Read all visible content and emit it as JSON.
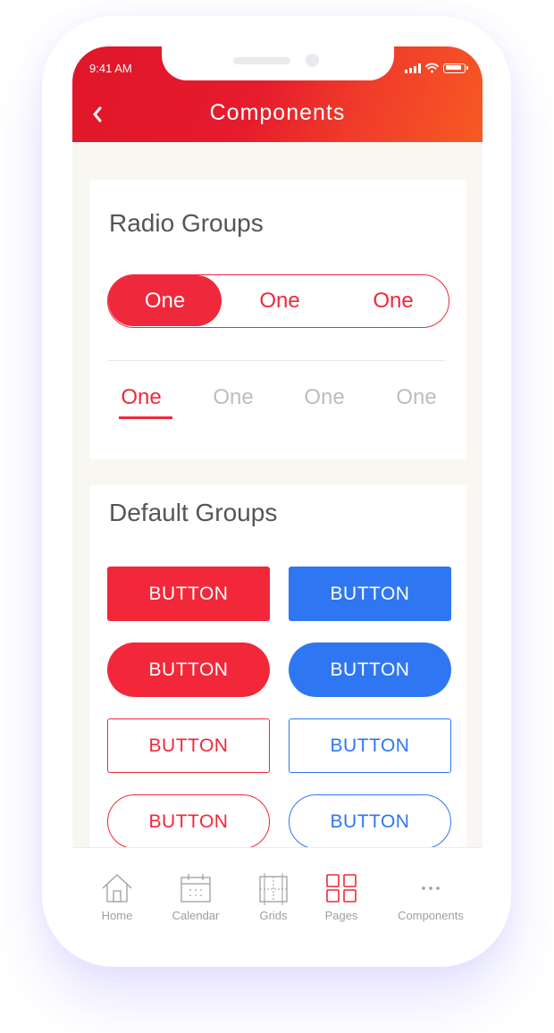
{
  "status_bar": {
    "time": "9:41 AM"
  },
  "header": {
    "title": "Components",
    "back_icon": "chevron-left-icon"
  },
  "colors": {
    "red": "#f22739",
    "blue": "#2f76f2",
    "header_start": "#e0162a",
    "header_end": "#f75a23"
  },
  "radio_groups": {
    "title": "Radio Groups",
    "segmented": {
      "options": [
        "One",
        "One",
        "One"
      ],
      "selected_index": 0
    },
    "tabs": {
      "options": [
        "One",
        "One",
        "One",
        "One"
      ],
      "selected_index": 0
    }
  },
  "default_groups": {
    "title": "Default Groups",
    "buttons": [
      {
        "label": "BUTTON",
        "style": "filled-square",
        "color": "red"
      },
      {
        "label": "BUTTON",
        "style": "filled-square",
        "color": "blue"
      },
      {
        "label": "BUTTON",
        "style": "filled-rounded",
        "color": "red"
      },
      {
        "label": "BUTTON",
        "style": "filled-rounded",
        "color": "blue"
      },
      {
        "label": "BUTTON",
        "style": "outline-square",
        "color": "red"
      },
      {
        "label": "BUTTON",
        "style": "outline-square",
        "color": "blue"
      },
      {
        "label": "BUTTON",
        "style": "outline-rounded",
        "color": "red"
      },
      {
        "label": "BUTTON",
        "style": "outline-rounded",
        "color": "blue"
      }
    ]
  },
  "tab_bar": {
    "items": [
      {
        "label": "Home",
        "icon": "home-icon"
      },
      {
        "label": "Calendar",
        "icon": "calendar-icon"
      },
      {
        "label": "Grids",
        "icon": "grid-layout-icon"
      },
      {
        "label": "Pages",
        "icon": "pages-icon"
      },
      {
        "label": "Components",
        "icon": "more-dots-icon"
      }
    ],
    "active_index": 3
  }
}
